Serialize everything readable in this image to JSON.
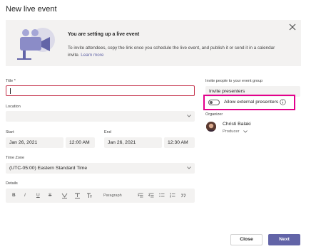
{
  "dialog": {
    "title": "New live event"
  },
  "banner": {
    "heading": "You are setting up a live event",
    "body": "To invite attendees, copy the link once you schedule the live event, and publish it or send it in a calendar invite.",
    "link": "Learn more",
    "close_icon": "close-icon"
  },
  "form": {
    "title_label": "Title *",
    "title_value": "",
    "location_label": "Location",
    "location_value": "",
    "start_label": "Start",
    "start_date": "Jan 26, 2021",
    "start_time": "12:00 AM",
    "end_label": "End",
    "end_date": "Jan 26, 2021",
    "end_time": "12:30 AM",
    "timezone_label": "Time Zone",
    "timezone_value": "(UTC-05:00) Eastern Standard Time",
    "details_label": "Details",
    "toolbar": {
      "bold": "B",
      "italic": "I",
      "underline": "U",
      "strike": "S",
      "paragraph": "Paragraph"
    }
  },
  "right": {
    "group_label": "Invite people to your event group",
    "invite_placeholder": "Invite presenters",
    "allow_external": "Allow external presenters",
    "allow_external_on": false,
    "organizer_label": "Organizer",
    "organizer_name": "Christi Balaki",
    "organizer_role": "Producer"
  },
  "footer": {
    "close_label": "Close",
    "next_label": "Next"
  },
  "colors": {
    "accent": "#6264a7",
    "highlight": "#e3008c",
    "required_border": "#c4314b"
  }
}
